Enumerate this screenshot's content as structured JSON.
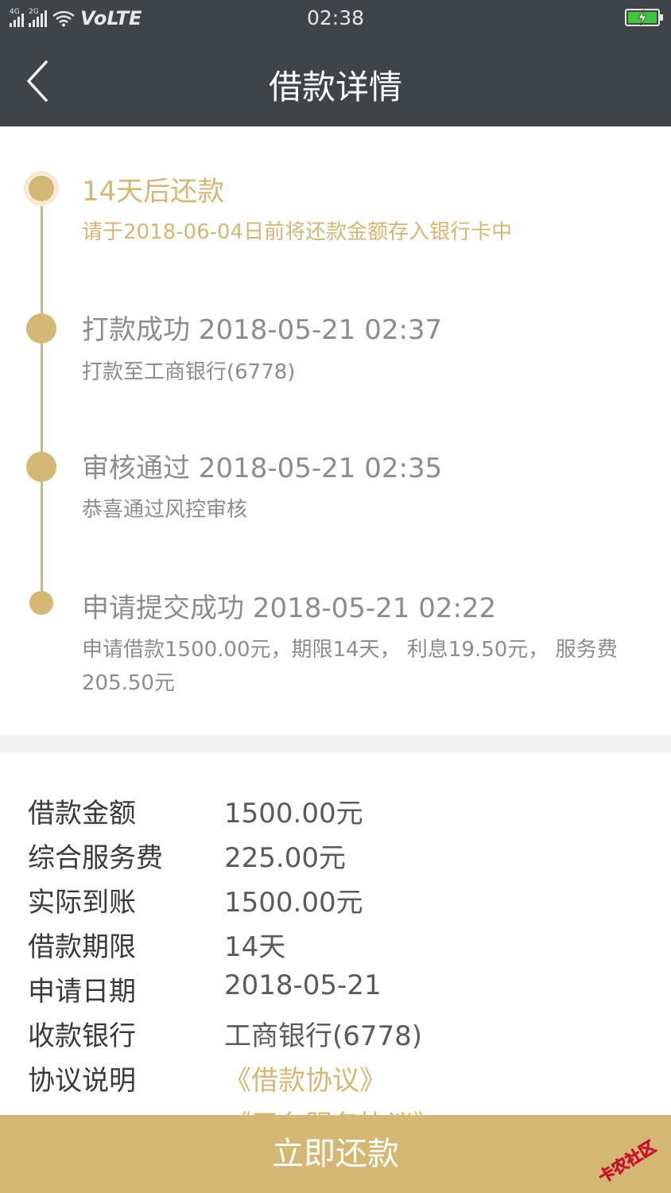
{
  "status_bar": {
    "network_1": "4G",
    "network_2": "2G",
    "carrier_label": "VoLTE",
    "time": "02:38",
    "battery_color": "#3ec73a"
  },
  "nav": {
    "title": "借款详情",
    "back_icon": "chevron-left-icon"
  },
  "timeline": {
    "accent_color": "#d5b774",
    "items": [
      {
        "title": "14天后还款",
        "desc": "请于2018-06-04日前将还款金额存入银行卡中",
        "state": "current"
      },
      {
        "title": "打款成功 2018-05-21 02:37",
        "desc": "打款至工商银行(6778)",
        "state": "done"
      },
      {
        "title": "审核通过 2018-05-21 02:35",
        "desc": "恭喜通过风控审核",
        "state": "done"
      },
      {
        "title": "申请提交成功 2018-05-21 02:22",
        "desc": "申请借款1500.00元，期限14天， 利息19.50元， 服务费205.50元",
        "state": "done"
      }
    ]
  },
  "details": {
    "rows": [
      {
        "label": "借款金额",
        "value": "1500.00元"
      },
      {
        "label": "综合服务费",
        "value": "225.00元"
      },
      {
        "label": "实际到账",
        "value": "1500.00元"
      },
      {
        "label": "借款期限",
        "value": "14天"
      },
      {
        "label": "申请日期",
        "value": "2018-05-21"
      },
      {
        "label": "收款银行",
        "value": "工商银行(6778)"
      },
      {
        "label": "协议说明",
        "value": "《借款协议》"
      }
    ],
    "partial_link": "《平台服务协议》"
  },
  "action": {
    "repay_label": "立即还款"
  },
  "watermark": {
    "text": "卡农社区"
  }
}
